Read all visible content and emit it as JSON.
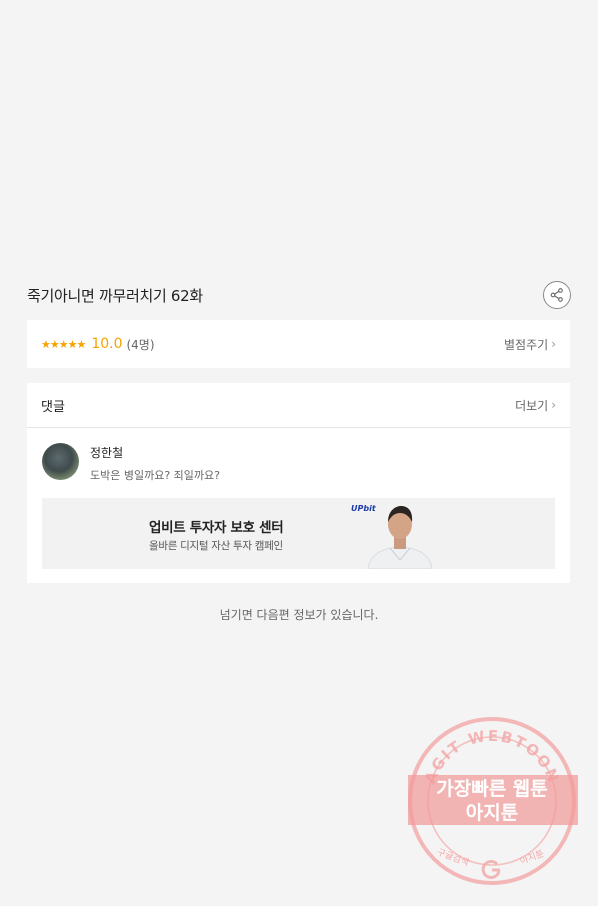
{
  "episode": {
    "title": "죽기아니면 까무러치기 62화"
  },
  "rating": {
    "stars": "★★★★★",
    "score": "10.0",
    "count": "(4명)",
    "rate_link": "별점주기"
  },
  "comments": {
    "title": "댓글",
    "more_link": "더보기",
    "items": [
      {
        "user": "정한철",
        "text": "도박은 병일까요? 죄일까요?"
      }
    ]
  },
  "ad": {
    "logo": "UPbit",
    "title": "업비트 투자자 보호 센터",
    "subtitle": "올바른 디지털 자산 투자 캠페인"
  },
  "footer": {
    "next_notice": "넘기면 다음편 정보가 있습니다."
  },
  "watermark": {
    "arc_text": "AGIT WEBTOON",
    "line1": "가장빠른 웹툰",
    "line2": "아지툰",
    "bottom_left": "구글검색",
    "bottom_right": "아지툰"
  },
  "icons": {
    "share": "share-icon",
    "chevron": "chevron-right-icon"
  },
  "colors": {
    "accent": "#f5a300",
    "background": "#f4f4f4",
    "watermark": "#f08e8e"
  }
}
